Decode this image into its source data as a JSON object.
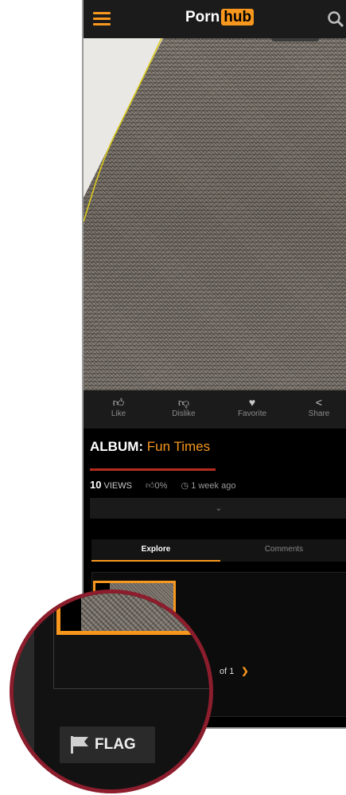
{
  "header": {
    "logo_left": "Porn",
    "logo_right": "hub"
  },
  "actions": {
    "like": "Like",
    "dislike": "Dislike",
    "favorite": "Favorite",
    "share": "Share"
  },
  "album": {
    "prefix": "ALBUM",
    "separator": ": ",
    "name": "Fun Times"
  },
  "stats": {
    "views_count": "10",
    "views_label": "VIEWS",
    "rating": "0%",
    "posted": "1 week ago"
  },
  "tabs": {
    "explore": "Explore",
    "comments": "Comments"
  },
  "pager": {
    "text": "of 1"
  },
  "flag": {
    "label": "FLAG"
  },
  "colors": {
    "accent": "#f7971d",
    "rating_bar": "#b52b1e",
    "magnifier_ring": "#8b1d2c"
  }
}
